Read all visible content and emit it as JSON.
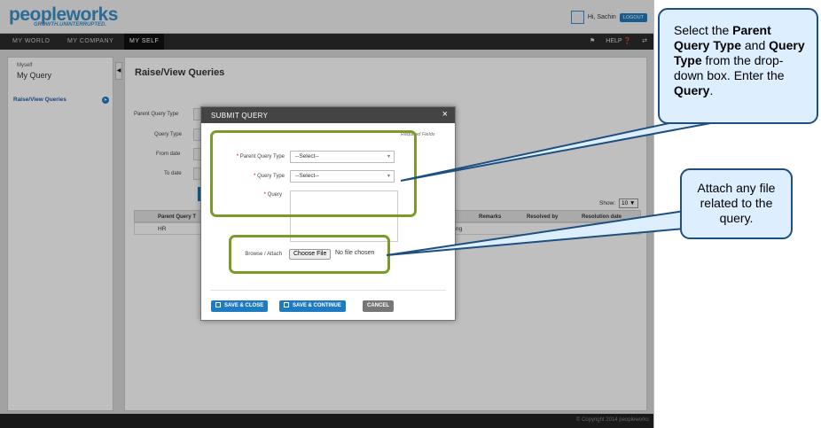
{
  "app": {
    "logo_main": "peopleworks",
    "logo_tagline": "GROWTH.UNINTERRUPTED.",
    "user_greeting": "Hi, Sachin",
    "logout_label": "LOGOUT",
    "nav": [
      "MY WORLD",
      "MY COMPANY",
      "MY SELF"
    ],
    "help_label": "HELP"
  },
  "sidebar": {
    "crumb_small": "Myself",
    "crumb_big": "My Query",
    "link": "Raise/View Queries"
  },
  "main": {
    "title": "Raise/View Queries",
    "filters": [
      "Parent Query Type",
      "Query Type",
      "From date",
      "To date"
    ],
    "show_label": "Show:",
    "show_value": "10",
    "columns": [
      "Parent Query T",
      "Remarks",
      "Resolved by",
      "Resolution date"
    ],
    "row": {
      "parent_query_type": "HR",
      "mid_fragment": "ng"
    }
  },
  "modal": {
    "title": "SUBMIT QUERY",
    "required_note": "Required Fields",
    "parent_query_label": "Parent Query Type",
    "parent_query_value": "--Select--",
    "query_type_label": "Query Type",
    "query_type_value": "--Select--",
    "query_label": "Query",
    "attach_label": "Browse / Attach",
    "choose_file": "Choose File",
    "no_file": "No file chosen",
    "buttons": {
      "save_close": "SAVE & CLOSE",
      "save_continue": "SAVE & CONTINUE",
      "cancel": "CANCEL"
    }
  },
  "footer": {
    "text": "© Copyright 2014  peopleworks"
  },
  "callouts": {
    "c1": {
      "l1": "Select the ",
      "b1": "Parent Query Type",
      "l2": " and ",
      "b2": "Query Type",
      "l3": " from the drop-down box. Enter the ",
      "b3": "Query",
      "l4": "."
    },
    "c2": "Attach any file related to the query."
  },
  "colors": {
    "accent": "#1f7bc1",
    "highlight": "#7a9a2a",
    "callout_fill": "#ddeeff",
    "callout_border": "#1e4f7f"
  }
}
